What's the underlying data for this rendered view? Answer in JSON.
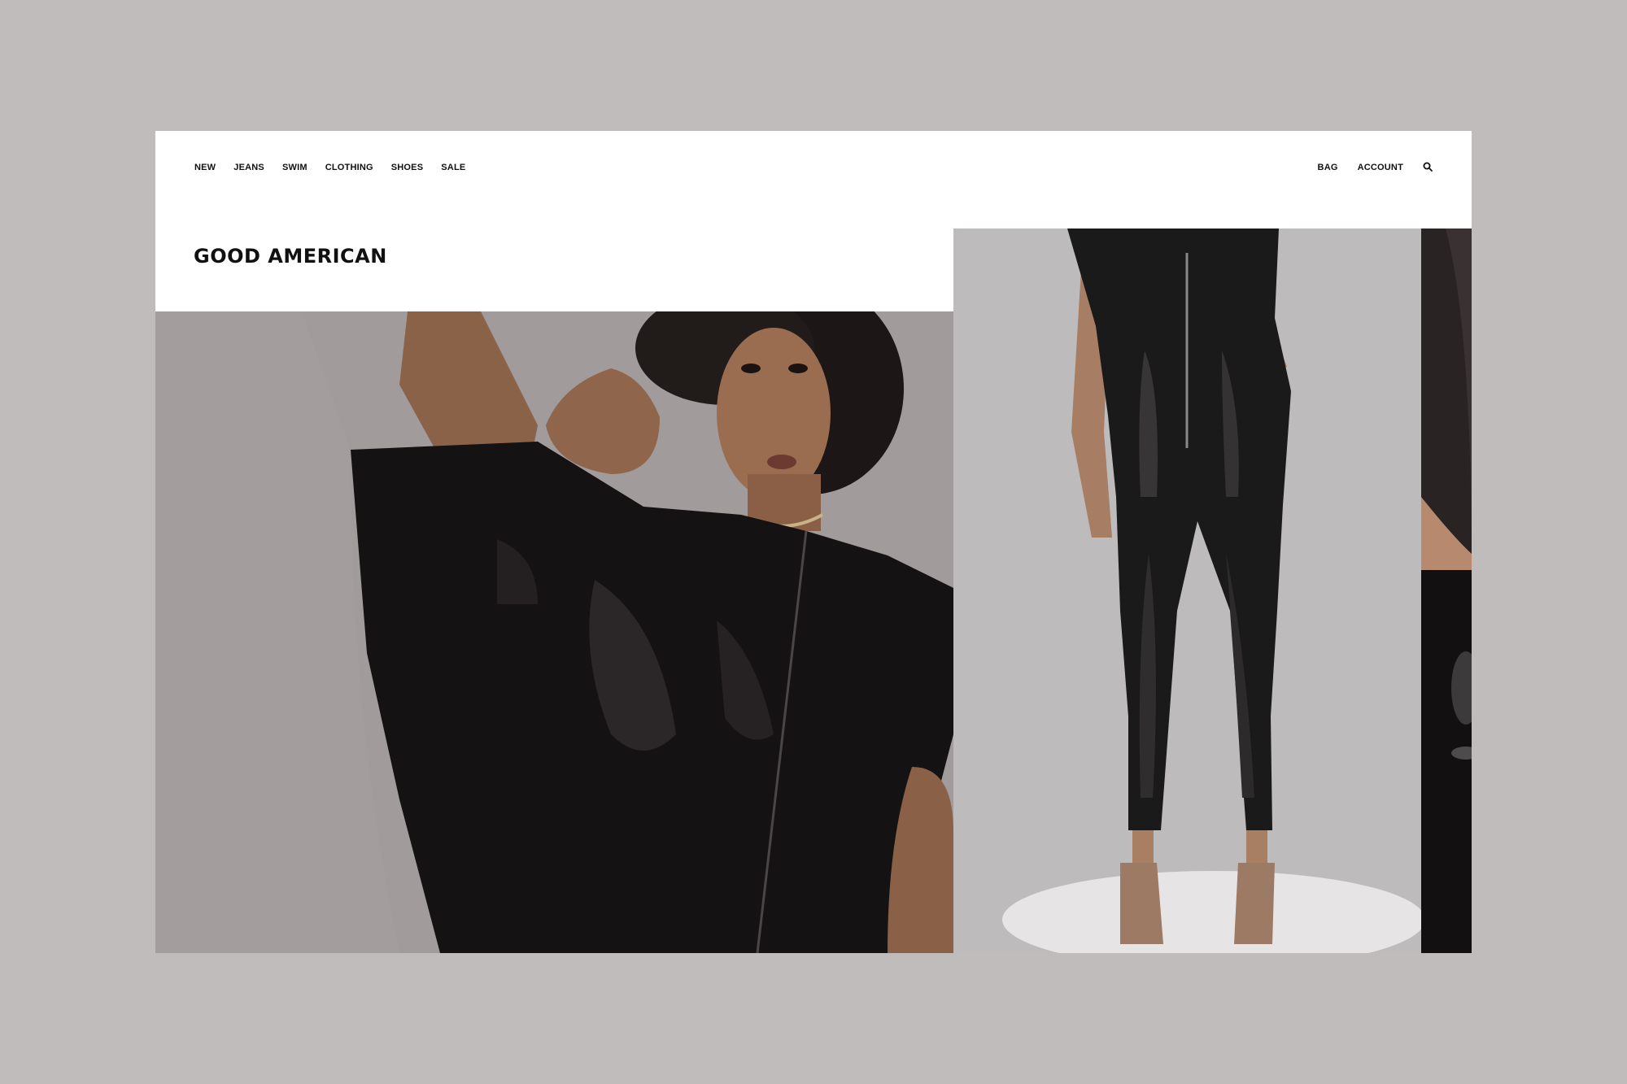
{
  "nav": {
    "left": [
      "NEW",
      "JEANS",
      "SWIM",
      "CLOTHING",
      "SHOES",
      "SALE"
    ],
    "right": [
      "BAG",
      "ACCOUNT"
    ],
    "search_icon": "search-icon"
  },
  "brand": {
    "name": "GOOD AMERICAN"
  },
  "colors": {
    "page_background": "#c0bcbb",
    "site_background": "#ffffff",
    "text": "#111111"
  }
}
